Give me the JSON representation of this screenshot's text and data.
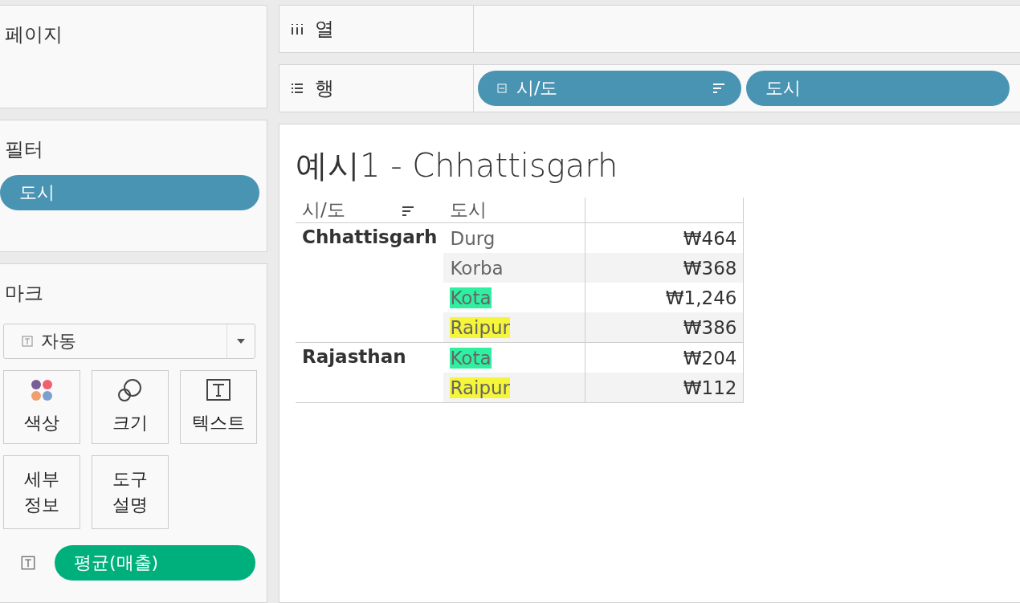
{
  "panels": {
    "pages": {
      "title": "페이지"
    },
    "filters": {
      "title": "필터",
      "pills": [
        "도시"
      ]
    },
    "marks": {
      "title": "마크",
      "mark_type": "자동",
      "cards": [
        {
          "kind": "color",
          "label": "색상"
        },
        {
          "kind": "size",
          "label": "크기"
        },
        {
          "kind": "text",
          "label": "텍스트"
        },
        {
          "kind": "detail",
          "label": "세부 정보"
        },
        {
          "kind": "tooltip",
          "label": "도구 설명"
        }
      ],
      "fields": [
        {
          "kind": "text",
          "label": "평균(매출)"
        }
      ]
    }
  },
  "shelves": {
    "columns": {
      "label": "열"
    },
    "rows": {
      "label": "행",
      "pills": [
        {
          "label": "시/도",
          "collapse": true,
          "sorted": true
        },
        {
          "label": "도시",
          "collapse": false,
          "sorted": false
        }
      ]
    }
  },
  "view": {
    "title": "예시1 - Chhattisgarh",
    "table": {
      "columns": [
        {
          "label": "시/도",
          "sorted": true
        },
        {
          "label": "도시",
          "sorted": false
        }
      ],
      "groups": [
        {
          "province": "Chhattisgarh",
          "rows": [
            {
              "city": "Durg",
              "value": "₩464"
            },
            {
              "city": "Korba",
              "value": "₩368"
            },
            {
              "city": "Kota",
              "value": "₩1,246",
              "color": "#2ef0a0"
            },
            {
              "city": "Raipur",
              "value": "₩386",
              "color": "#f5f53a"
            }
          ]
        },
        {
          "province": "Rajasthan",
          "rows": [
            {
              "city": "Kota",
              "value": "₩204",
              "color": "#2ef0a0"
            },
            {
              "city": "Raipur",
              "value": "₩112",
              "color": "#f5f53a"
            }
          ]
        }
      ]
    }
  }
}
